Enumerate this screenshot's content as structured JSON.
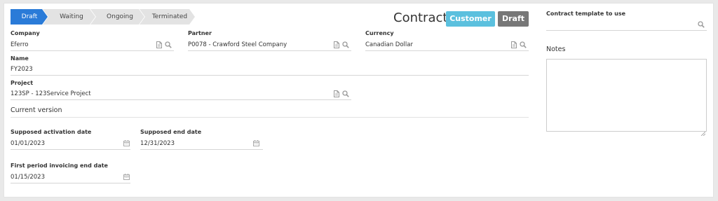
{
  "statusbar": {
    "steps": [
      {
        "label": "Draft"
      },
      {
        "label": "Waiting"
      },
      {
        "label": "Ongoing"
      },
      {
        "label": "Terminated"
      }
    ],
    "active_index": 0,
    "active_color": "#2a7bd8",
    "inactive_color": "#e3e3e3"
  },
  "header": {
    "title": "Contract",
    "badge_customer": "Customer",
    "badge_status": "Draft"
  },
  "form": {
    "company": {
      "label": "Company",
      "value": "Eferro"
    },
    "partner": {
      "label": "Partner",
      "value": "P0078 - Crawford Steel Company"
    },
    "currency": {
      "label": "Currency",
      "value": "Canadian Dollar"
    },
    "name": {
      "label": "Name",
      "value": "FY2023"
    },
    "project": {
      "label": "Project",
      "value": "123SP - 123Service Project"
    },
    "current_version": "Current version",
    "activation_date": {
      "label": "Supposed activation date",
      "value": "01/01/2023"
    },
    "end_date": {
      "label": "Supposed end date",
      "value": "12/31/2023"
    },
    "first_period": {
      "label": "First period invoicing end date",
      "value": "01/15/2023"
    }
  },
  "side": {
    "template_label": "Contract template to use",
    "template_value": "",
    "notes_label": "Notes",
    "notes_value": ""
  },
  "icons": {
    "edit": "document-icon",
    "search": "search-icon",
    "calendar": "calendar-icon"
  }
}
